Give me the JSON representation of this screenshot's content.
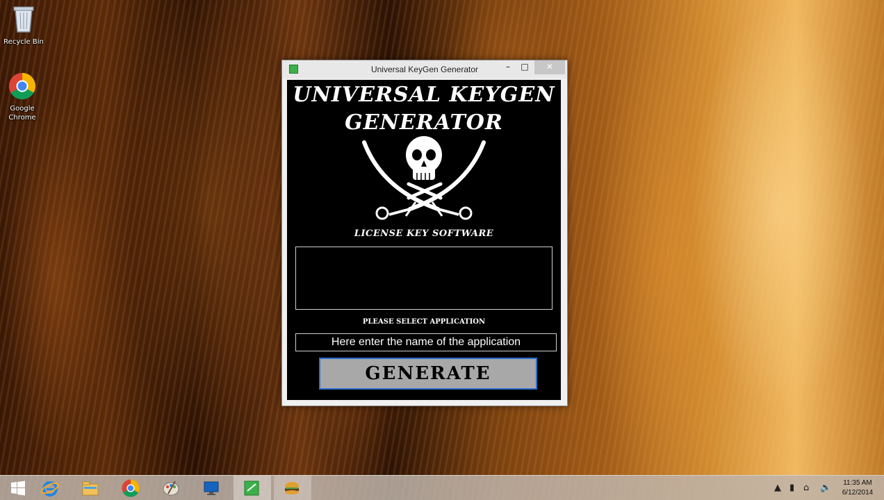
{
  "desktop": {
    "icons": [
      {
        "label": "Recycle Bin"
      },
      {
        "label": "Google Chrome"
      }
    ]
  },
  "window": {
    "title": "Universal KeyGen Generator",
    "minimize_label": "–",
    "maximize_label": "□",
    "close_label": "✕"
  },
  "app": {
    "banner_line1": "Universal KeyGen",
    "banner_line2": "Generator",
    "tagline": "LICENSE KEY SOFTWARE",
    "select_label": "PLEASE SELECT APPLICATION",
    "input_placeholder": "Here enter the name of the application",
    "input_value": "",
    "generate_label": "GENERATE"
  },
  "taskbar": {
    "buttons": [
      "start",
      "internet-explorer",
      "file-explorer",
      "chrome",
      "paint",
      "remote-desktop",
      "keygen",
      "other-app"
    ],
    "tray_icons": [
      "show-hidden-icons",
      "battery",
      "network",
      "volume"
    ],
    "clock_time": "11:35 AM",
    "clock_date": "6/12/2014"
  },
  "colors": {
    "window_bg": "#000000",
    "generate_bg": "#a8a8a8",
    "generate_border": "#2e6fd1",
    "close_bg": "#c7c7c7"
  }
}
